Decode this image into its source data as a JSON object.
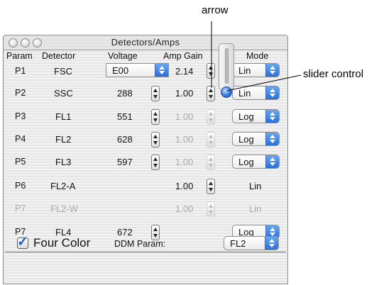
{
  "annotations": {
    "arrow": "arrow",
    "slider_control": "slider control"
  },
  "window": {
    "title": "Detectors/Amps"
  },
  "headers": {
    "param": "Param",
    "detector": "Detector",
    "voltage": "Voltage",
    "amp_gain": "Amp Gain",
    "mode": "Mode"
  },
  "rows": [
    {
      "param": "P1",
      "detector": "FSC",
      "voltage": "E00",
      "amp_gain": "2.14",
      "mode": "Lin"
    },
    {
      "param": "P2",
      "detector": "SSC",
      "voltage": "288",
      "amp_gain": "1.00",
      "mode": "Lin"
    },
    {
      "param": "P3",
      "detector": "FL1",
      "voltage": "551",
      "amp_gain": "1.00",
      "mode": "Log"
    },
    {
      "param": "P4",
      "detector": "FL2",
      "voltage": "628",
      "amp_gain": "1.00",
      "mode": "Log"
    },
    {
      "param": "P5",
      "detector": "FL3",
      "voltage": "597",
      "amp_gain": "1.00",
      "mode": "Log"
    },
    {
      "param": "P6",
      "detector": "FL2-A",
      "voltage": "",
      "amp_gain": "1.00",
      "mode": "Lin"
    },
    {
      "param": "P7",
      "detector": "FL2-W",
      "voltage": "",
      "amp_gain": "1.00",
      "mode": "Lin"
    },
    {
      "param": "P7",
      "detector": "FL4",
      "voltage": "672",
      "amp_gain": "",
      "mode": "Log"
    }
  ],
  "footer": {
    "four_color_label": "Four Color",
    "four_color_checked": true,
    "ddm_label": "DDM Param:",
    "ddm_value": "FL2"
  },
  "colors": {
    "accent": "#2a6fd6",
    "disabled_text": "#a8a8a8"
  }
}
